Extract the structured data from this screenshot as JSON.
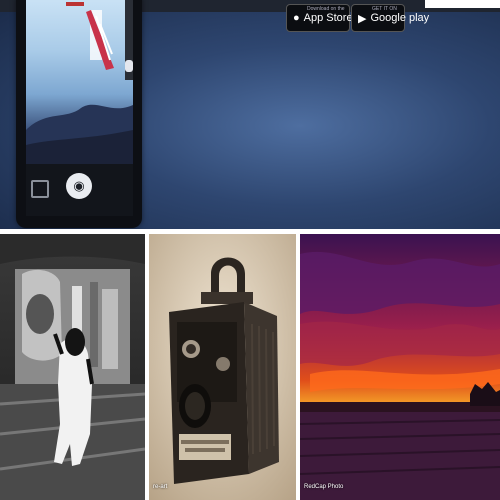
{
  "stores": {
    "apple": {
      "label": "App Store",
      "sub": "Download on the"
    },
    "google": {
      "label": "Google play",
      "sub": "GET IT ON"
    }
  },
  "tiles": [
    {
      "caption": ""
    },
    {
      "caption": "re-art"
    },
    {
      "caption": "RedCap Photo"
    }
  ]
}
